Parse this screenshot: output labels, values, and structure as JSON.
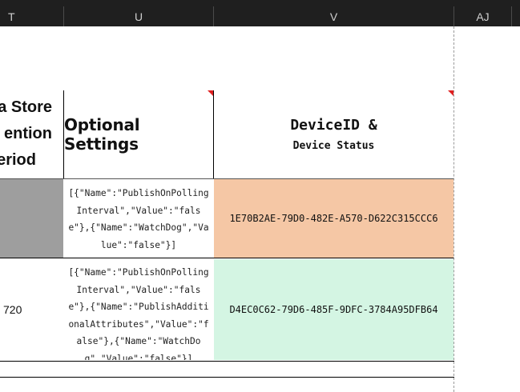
{
  "columns": [
    {
      "letter": "T"
    },
    {
      "letter": "U"
    },
    {
      "letter": "V"
    },
    {
      "letter": "AJ"
    }
  ],
  "header_row": {
    "col_t_lines": [
      "a Store",
      "ention",
      "eriod"
    ],
    "col_u": "Optional Settings",
    "col_v_line1": "DeviceID &",
    "col_v_line2": "Device Status"
  },
  "rows": [
    {
      "col_t": "",
      "col_u": "[{\"Name\":\"PublishOnPollingInterval\",\"Value\":\"false\"},{\"Name\":\"WatchDog\",\"Value\":\"false\"}]",
      "col_v": "1E70B2AE-79D0-482E-A570-D622C315CCC6",
      "col_t_fill": "#9e9e9e",
      "col_v_fill": "#f5c7a5"
    },
    {
      "col_t": "720",
      "col_u": "[{\"Name\":\"PublishOnPollingInterval\",\"Value\":\"false\"},{\"Name\":\"PublishAdditionalAttributes\",\"Value\":\"false\"},{\"Name\":\"WatchDog\",\"Value\":\"false\"}]",
      "col_v": "D4EC0C62-79D6-485F-9DFC-3784A95DFB64",
      "col_t_fill": "#ffffff",
      "col_v_fill": "#d4f5e3"
    }
  ],
  "colors": {
    "header_bg": "#1f1f1f",
    "header_text": "#cfcfcf",
    "comment_marker": "#e02020"
  }
}
